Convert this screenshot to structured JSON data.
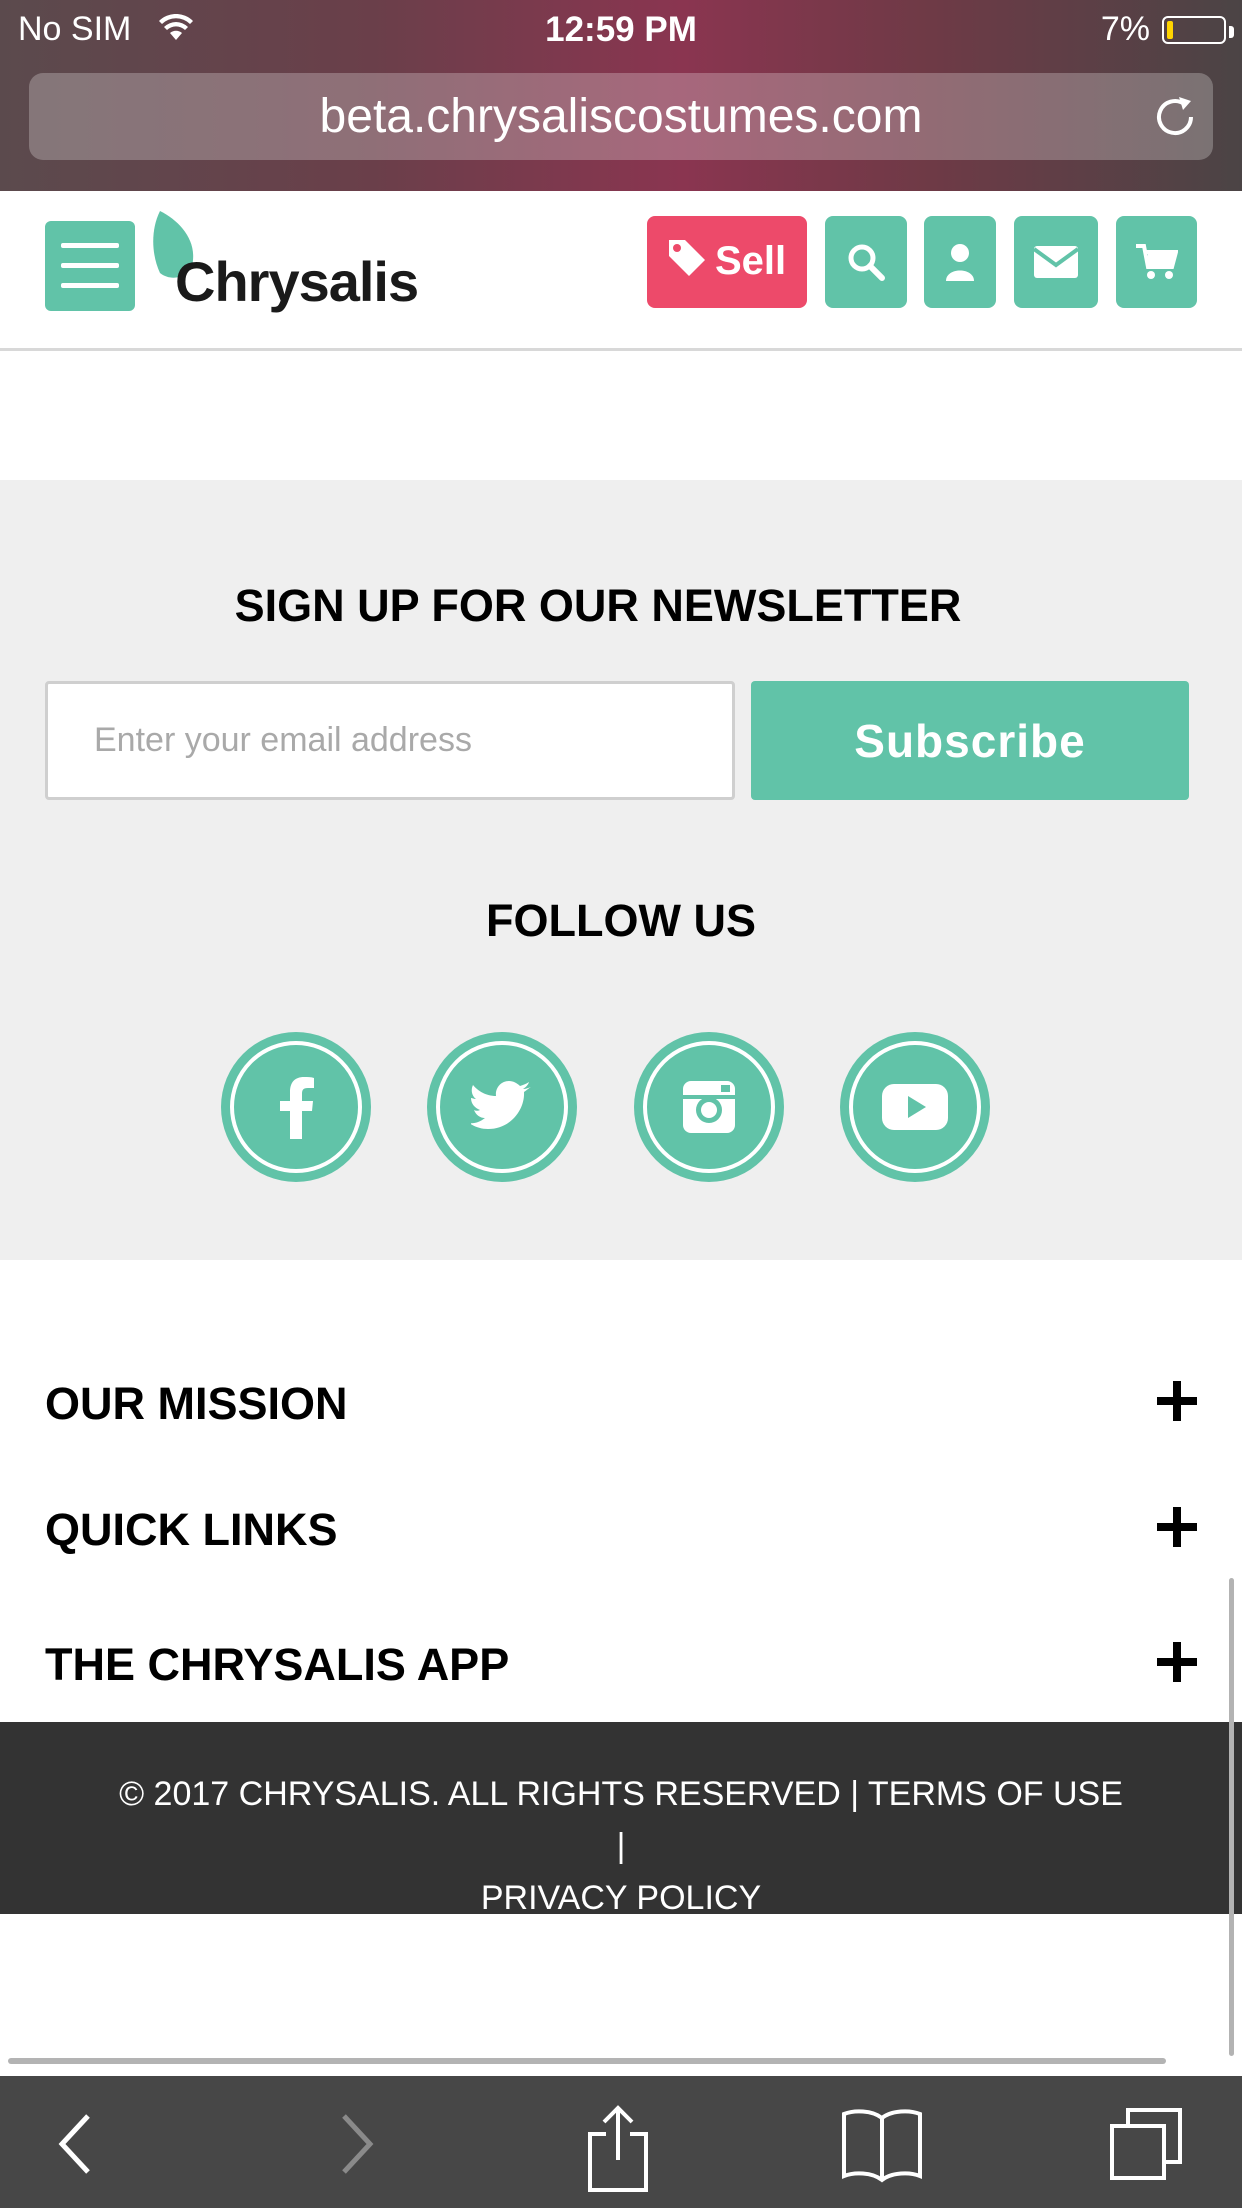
{
  "status_bar": {
    "carrier": "No SIM",
    "time": "12:59 PM",
    "battery": "7%"
  },
  "browser": {
    "url": "beta.chrysaliscostumes.com"
  },
  "header": {
    "logo_text": "Chrysalis",
    "sell_label": "Sell",
    "accent": "#61c3a8",
    "sell_color": "#ed4a6a"
  },
  "newsletter": {
    "title": "SIGN UP FOR OUR NEWSLETTER",
    "email_placeholder": "Enter your email address",
    "subscribe_label": "Subscribe",
    "follow_title": "FOLLOW US",
    "social_icons": [
      "facebook-icon",
      "twitter-icon",
      "instagram-icon",
      "youtube-icon"
    ]
  },
  "footer": {
    "sections": [
      "OUR MISSION",
      "QUICK LINKS",
      "THE CHRYSALIS APP"
    ],
    "copyright_line1": "© 2017 CHRYSALIS. ALL RIGHTS RESERVED | TERMS OF USE |",
    "copyright_line2": "PRIVACY POLICY"
  }
}
